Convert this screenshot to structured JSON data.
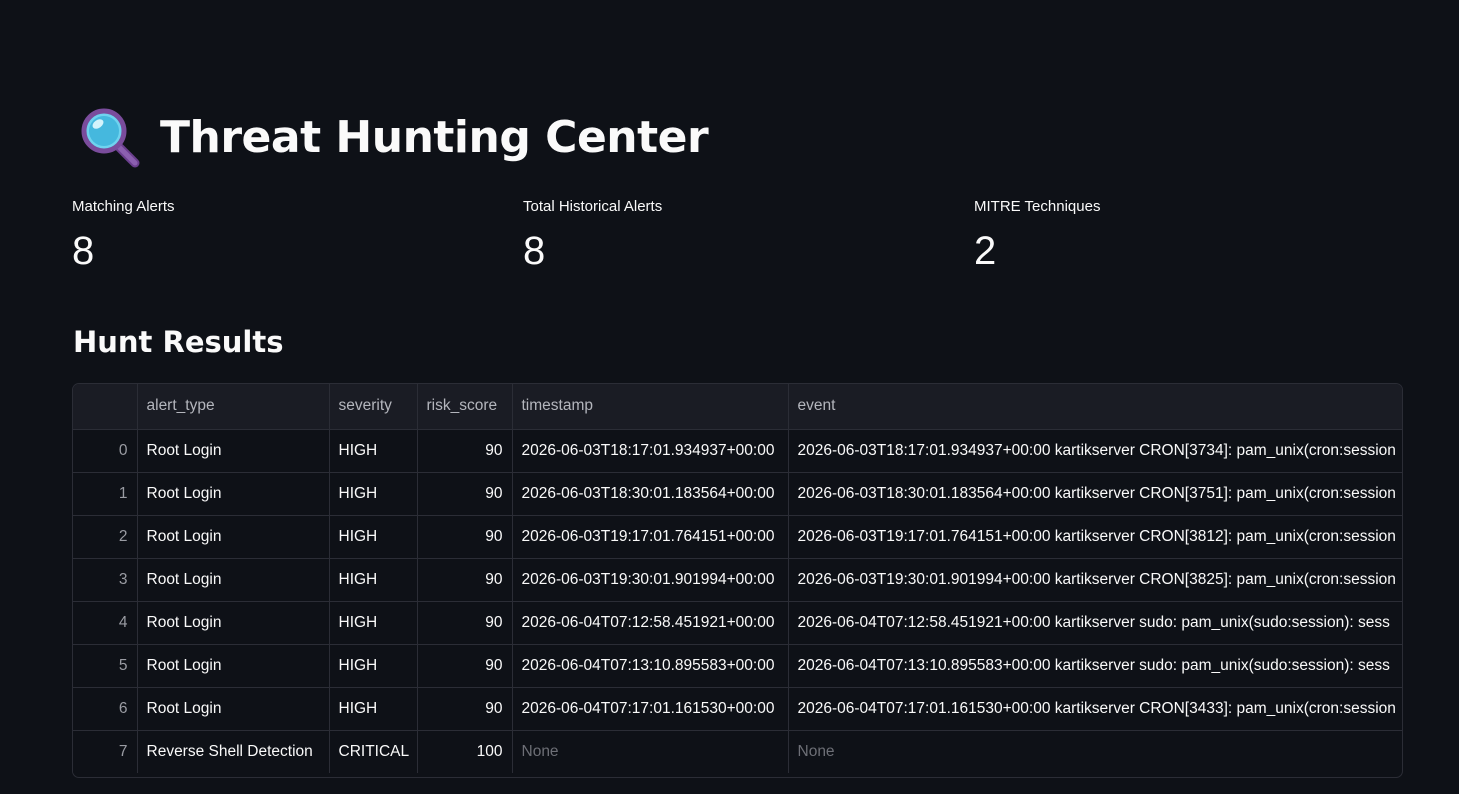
{
  "header": {
    "title": "Threat Hunting Center",
    "icon": "magnifying-glass-icon"
  },
  "metrics": [
    {
      "label": "Matching Alerts",
      "value": "8"
    },
    {
      "label": "Total Historical Alerts",
      "value": "8"
    },
    {
      "label": "MITRE Techniques",
      "value": "2"
    }
  ],
  "results": {
    "title": "Hunt Results",
    "columns": [
      "",
      "alert_type",
      "severity",
      "risk_score",
      "timestamp",
      "event"
    ],
    "rows": [
      {
        "index": "0",
        "alert_type": "Root Login",
        "severity": "HIGH",
        "risk_score": "90",
        "timestamp": "2026-06-03T18:17:01.934937+00:00",
        "event": "2026-06-03T18:17:01.934937+00:00 kartikserver CRON[3734]: pam_unix(cron:session"
      },
      {
        "index": "1",
        "alert_type": "Root Login",
        "severity": "HIGH",
        "risk_score": "90",
        "timestamp": "2026-06-03T18:30:01.183564+00:00",
        "event": "2026-06-03T18:30:01.183564+00:00 kartikserver CRON[3751]: pam_unix(cron:session"
      },
      {
        "index": "2",
        "alert_type": "Root Login",
        "severity": "HIGH",
        "risk_score": "90",
        "timestamp": "2026-06-03T19:17:01.764151+00:00",
        "event": "2026-06-03T19:17:01.764151+00:00 kartikserver CRON[3812]: pam_unix(cron:session"
      },
      {
        "index": "3",
        "alert_type": "Root Login",
        "severity": "HIGH",
        "risk_score": "90",
        "timestamp": "2026-06-03T19:30:01.901994+00:00",
        "event": "2026-06-03T19:30:01.901994+00:00 kartikserver CRON[3825]: pam_unix(cron:session"
      },
      {
        "index": "4",
        "alert_type": "Root Login",
        "severity": "HIGH",
        "risk_score": "90",
        "timestamp": "2026-06-04T07:12:58.451921+00:00",
        "event": "2026-06-04T07:12:58.451921+00:00 kartikserver sudo: pam_unix(sudo:session): sess"
      },
      {
        "index": "5",
        "alert_type": "Root Login",
        "severity": "HIGH",
        "risk_score": "90",
        "timestamp": "2026-06-04T07:13:10.895583+00:00",
        "event": "2026-06-04T07:13:10.895583+00:00 kartikserver sudo: pam_unix(sudo:session): sess"
      },
      {
        "index": "6",
        "alert_type": "Root Login",
        "severity": "HIGH",
        "risk_score": "90",
        "timestamp": "2026-06-04T07:17:01.161530+00:00",
        "event": "2026-06-04T07:17:01.161530+00:00 kartikserver CRON[3433]: pam_unix(cron:session"
      },
      {
        "index": "7",
        "alert_type": "Reverse Shell Detection",
        "severity": "CRITICAL",
        "risk_score": "100",
        "timestamp": "None",
        "event": "None"
      }
    ]
  },
  "colors": {
    "background": "#0e1117",
    "text": "#fafafa",
    "table_border": "#2b2d36",
    "table_header_bg": "#1a1c24",
    "muted_text": "#6d6f76"
  }
}
